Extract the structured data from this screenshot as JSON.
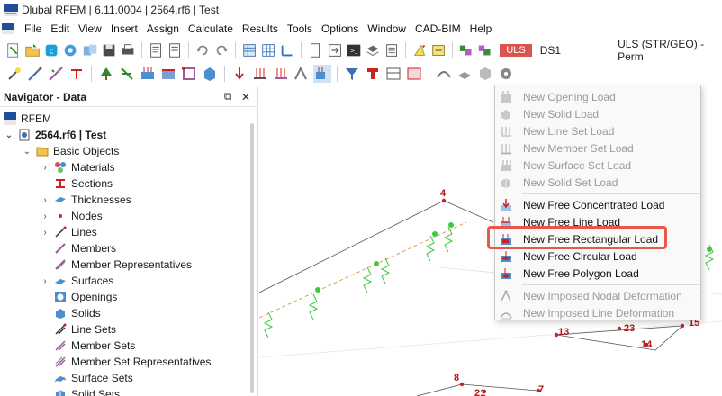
{
  "window": {
    "title": "Dlubal RFEM | 6.11.0004 | 2564.rf6 | Test"
  },
  "menu": [
    "File",
    "Edit",
    "View",
    "Insert",
    "Assign",
    "Calculate",
    "Results",
    "Tools",
    "Options",
    "Window",
    "CAD-BIM",
    "Help"
  ],
  "toolbar": {
    "uls_label": "ULS",
    "ds_label": "DS1",
    "combo_text": "ULS (STR/GEO) - Perm"
  },
  "navigator": {
    "title": "Navigator - Data",
    "root": "RFEM",
    "file": "2564.rf6 | Test",
    "group": "Basic Objects",
    "items": [
      "Materials",
      "Sections",
      "Thicknesses",
      "Nodes",
      "Lines",
      "Members",
      "Member Representatives",
      "Surfaces",
      "Openings",
      "Solids",
      "Line Sets",
      "Member Sets",
      "Member Set Representatives",
      "Surface Sets",
      "Solid Sets"
    ]
  },
  "viewport": {
    "node_labels": [
      "4",
      "13",
      "23",
      "14",
      "15",
      "8",
      "21",
      "7"
    ]
  },
  "dropdown": {
    "group1": [
      "New Opening Load",
      "New Solid Load",
      "New Line Set Load",
      "New Member Set Load",
      "New Surface Set Load",
      "New Solid Set Load"
    ],
    "group2": [
      "New Free Concentrated Load",
      "New Free Line Load",
      "New Free Rectangular Load",
      "New Free Circular Load",
      "New Free Polygon Load"
    ],
    "group3": [
      "New Imposed Nodal Deformation",
      "New Imposed Line Deformation"
    ],
    "highlighted": "New Free Rectangular Load"
  },
  "colors": {
    "highlight": "#e8574a",
    "uls_badge": "#d9534f",
    "support_green": "#3fc93f",
    "node_red": "#d11f1f"
  }
}
